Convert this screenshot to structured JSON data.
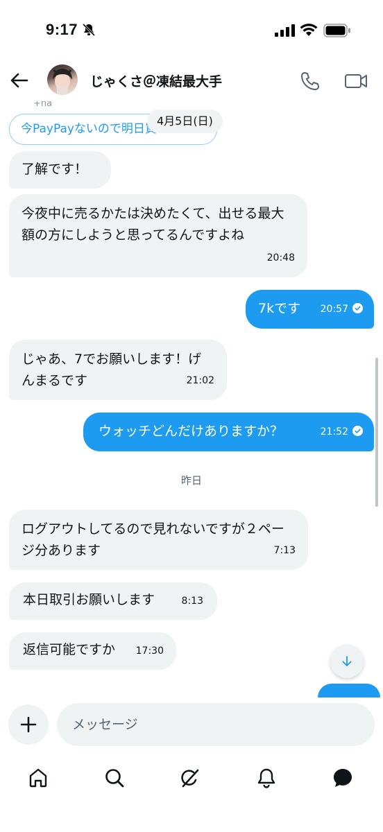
{
  "status_bar": {
    "time": "9:17"
  },
  "header": {
    "name": "じゃくさ＠凍結最大手"
  },
  "chat": {
    "partial_label": "+ha",
    "reply_preview": "今PayPayないので明日買います",
    "date_chip": "4月5日(日)",
    "day_separator": "昨日",
    "messages": [
      {
        "dir": "in",
        "text": "了解です！",
        "time": ""
      },
      {
        "dir": "in",
        "text": "今夜中に売るかたは決めたくて、出せる最大額の方にしようと思ってるんですよね",
        "time": "20:48"
      },
      {
        "dir": "out",
        "text": "7kです",
        "time": "20:57"
      },
      {
        "dir": "in",
        "text": "じゃあ、7でお願いします！げんまるです",
        "time": "21:02"
      },
      {
        "dir": "out",
        "text": "ウォッチどんだけありますか？",
        "time": "21:52"
      },
      {
        "dir": "in",
        "text": "ログアウトしてるので見れないですが２ページ分あります",
        "time": "7:13"
      },
      {
        "dir": "in",
        "text": "本日取引お願いします",
        "time": "8:13"
      },
      {
        "dir": "in",
        "text": "返信可能ですか",
        "time": "17:30"
      }
    ]
  },
  "composer": {
    "placeholder": "メッセージ"
  },
  "colors": {
    "accent": "#1d9bf0",
    "incoming_bubble": "#eff3f4",
    "text": "#0f1419"
  },
  "icons": [
    "mute-icon",
    "signal-icon",
    "wifi-icon",
    "battery-icon",
    "back-icon",
    "phone-icon",
    "video-icon",
    "check-icon",
    "arrow-down-icon",
    "plus-icon",
    "home-icon",
    "search-icon",
    "grok-icon",
    "bell-icon",
    "messages-icon"
  ]
}
